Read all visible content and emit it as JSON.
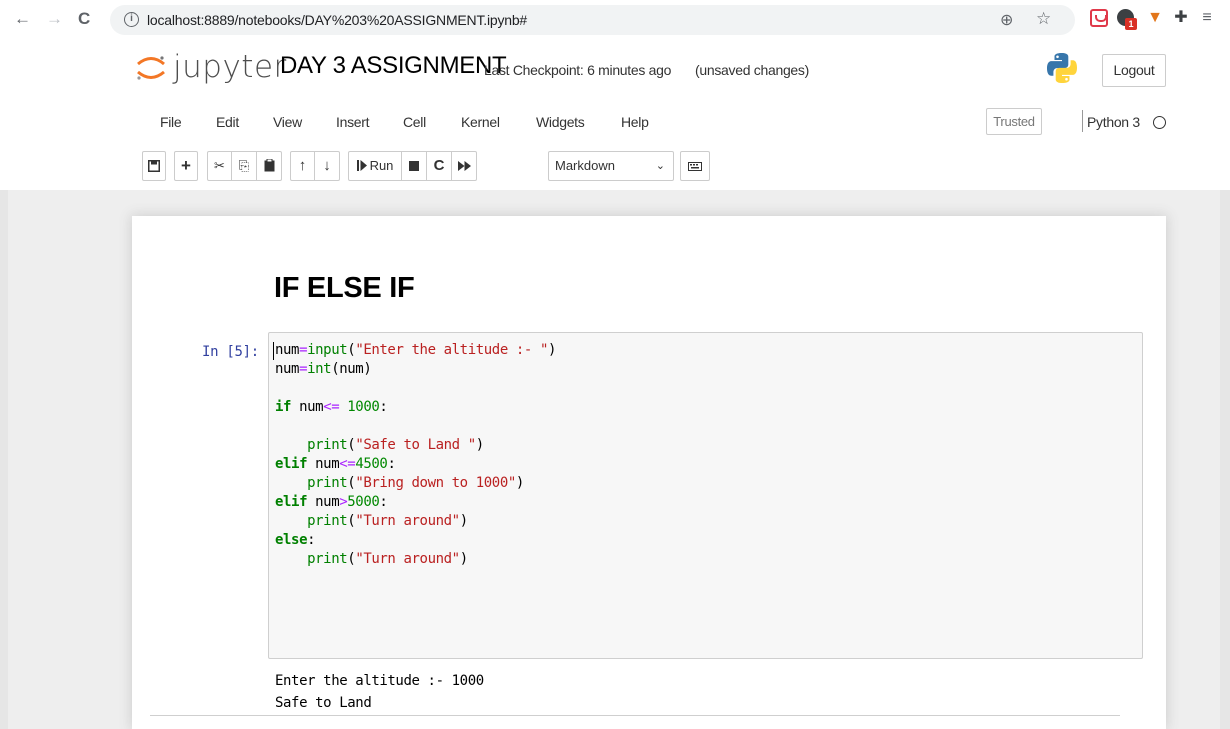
{
  "browser": {
    "back": "←",
    "forward": "→",
    "reload": "C",
    "url": "localhost:8889/notebooks/DAY%203%20ASSIGNMENT.ipynb#",
    "info_glyph": "i",
    "zoom_glyph": "⊕",
    "star_glyph": "☆",
    "extension_badge": "1",
    "menu_glyph": "≡"
  },
  "header": {
    "logo_text": "jupyter",
    "notebook_title": "DAY 3 ASSIGNMENT",
    "checkpoint": "Last Checkpoint: 6 minutes ago",
    "autosave_status": "(unsaved changes)",
    "logout_label": "Logout"
  },
  "menubar": {
    "items": [
      "File",
      "Edit",
      "View",
      "Insert",
      "Cell",
      "Kernel",
      "Widgets",
      "Help"
    ],
    "trusted_label": "Trusted",
    "kernel_name": "Python 3"
  },
  "toolbar": {
    "save_icon": "🖫",
    "add_icon": "+",
    "cut_icon": "✂",
    "copy_icon": "⎘",
    "paste_icon": "📋",
    "up_icon": "↑",
    "down_icon": "↓",
    "run_label": "Run",
    "run_glyph": "▶|",
    "stop_icon": "■",
    "restart_icon": "C",
    "fast_forward_icon": "⏩",
    "cell_type": "Markdown",
    "keyboard_icon": "⌨"
  },
  "notebook": {
    "heading": "IF ELSE IF",
    "prompt": "In [5]:",
    "output_lines": [
      "Enter the altitude :- 1000",
      "Safe to Land"
    ]
  }
}
